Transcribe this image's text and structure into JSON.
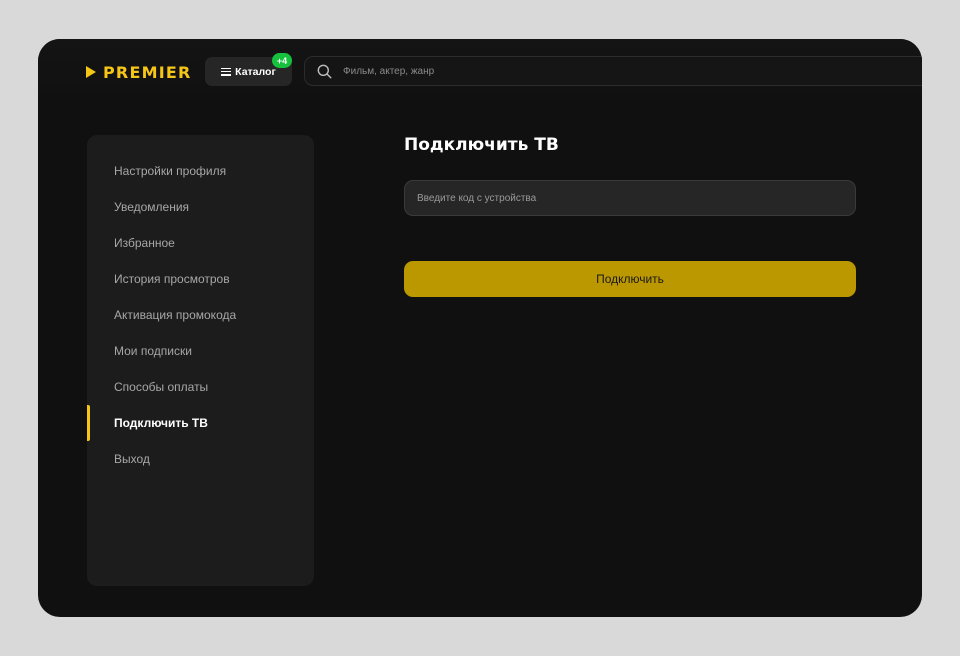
{
  "header": {
    "logo_text": "PREMIER",
    "catalog_label": "Каталог",
    "catalog_badge": "+4",
    "search": {
      "placeholder": "Фильм, актер, жанр",
      "value": ""
    }
  },
  "sidebar": {
    "items": [
      {
        "label": "Настройки профиля",
        "active": false
      },
      {
        "label": "Уведомления",
        "active": false
      },
      {
        "label": "Избранное",
        "active": false
      },
      {
        "label": "История просмотров",
        "active": false
      },
      {
        "label": "Активация промокода",
        "active": false
      },
      {
        "label": "Мои подписки",
        "active": false
      },
      {
        "label": "Способы оплаты",
        "active": false
      },
      {
        "label": "Подключить ТВ",
        "active": true
      },
      {
        "label": "Выход",
        "active": false
      }
    ]
  },
  "main": {
    "title": "Подключить ТВ",
    "code_input": {
      "placeholder": "Введите код с устройства",
      "value": ""
    },
    "connect_label": "Подключить"
  },
  "colors": {
    "brand": "#f5c518",
    "badge": "#16c23d",
    "button": "#bb9800",
    "background": "#101010"
  },
  "icons": {
    "logo": "play-triangle-icon",
    "catalog": "hamburger-menu-icon",
    "search": "search-icon"
  }
}
